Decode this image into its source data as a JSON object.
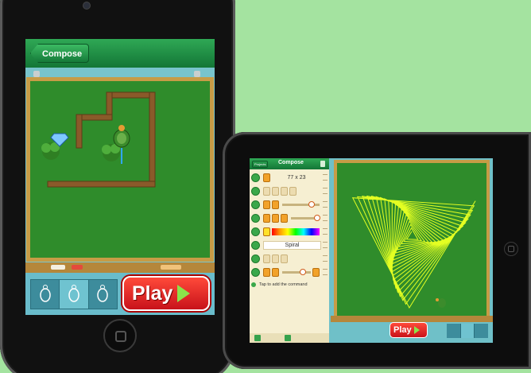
{
  "phone": {
    "nav": {
      "back_label": "Compose"
    },
    "play_label": "Play",
    "tools": [
      "turtle-tool",
      "turtle-tool-active",
      "turtle-tool"
    ]
  },
  "tablet": {
    "nav": {
      "projects_label": "Projects",
      "title": "Compose"
    },
    "command_size": "77  x  23",
    "spiral_label": "Spiral",
    "add_command_label": "Tap to add the command",
    "play_label": "Play"
  },
  "colors": {
    "background": "#a4e3a0",
    "nav_green": "#1e8f45",
    "chalkboard": "#2f8c2b",
    "board_frame": "#c79c46",
    "play_red": "#d81e22",
    "spiral_yellow": "#e4ff22"
  }
}
